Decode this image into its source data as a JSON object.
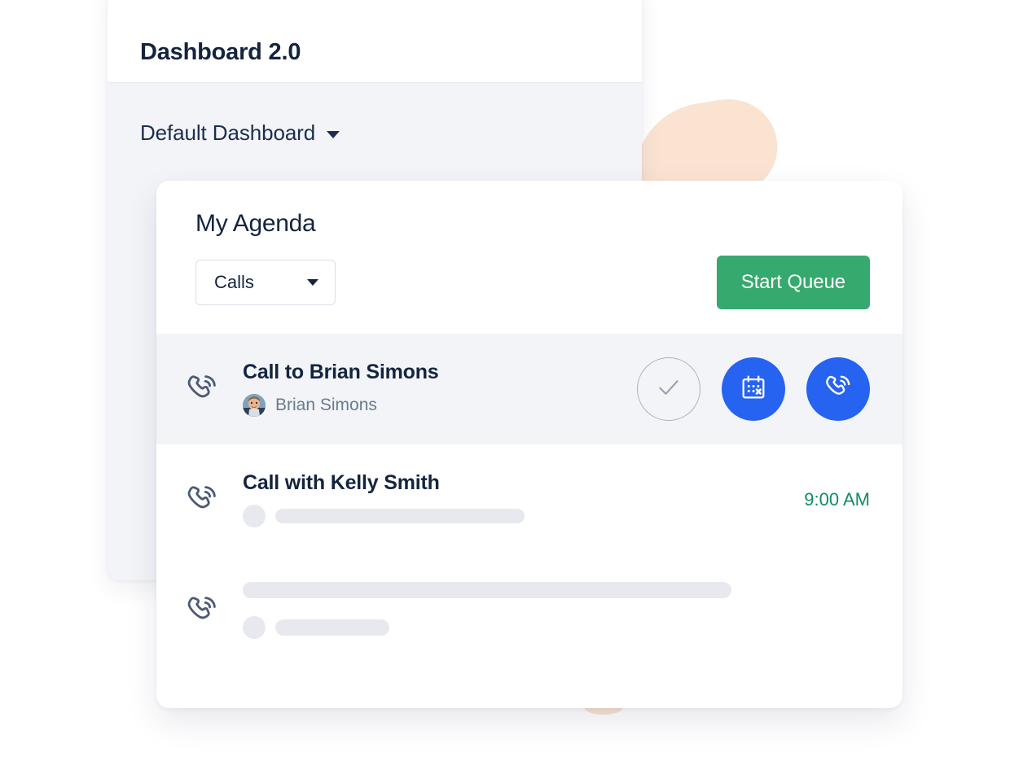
{
  "back_card": {
    "title": "Dashboard 2.0",
    "selector": {
      "label": "Default Dashboard",
      "icon": "chevron-down-icon"
    }
  },
  "agenda_card": {
    "title": "My Agenda",
    "filter": {
      "selected": "Calls",
      "icon": "chevron-down-icon"
    },
    "start_queue_label": "Start Queue",
    "rows": [
      {
        "icon": "phone-call-icon",
        "title": "Call to Brian Simons",
        "contact_name": "Brian Simons",
        "avatar": "user-photo-avatar",
        "time": "",
        "active": true,
        "actions": [
          {
            "icon": "check-icon",
            "style": "outline",
            "name": "complete-task-button"
          },
          {
            "icon": "calendar-cancel-icon",
            "style": "filled",
            "name": "reschedule-task-button"
          },
          {
            "icon": "phone-call-icon",
            "style": "filled",
            "name": "call-now-button"
          }
        ]
      },
      {
        "icon": "phone-call-icon",
        "title": "Call with Kelly Smith",
        "contact_name": "",
        "time": "9:00 AM",
        "active": false,
        "actions": []
      },
      {
        "icon": "phone-call-icon",
        "title": "",
        "contact_name": "",
        "time": "",
        "active": false,
        "actions": []
      }
    ]
  },
  "colors": {
    "accent_blue": "#2563F0",
    "accent_green": "#36A96E",
    "time_green": "#0E8E5F",
    "navy_text": "#14243F",
    "muted_text": "#6B7A90",
    "row_active_bg": "#F2F4F7",
    "back_card_bg": "#F2F4F7",
    "blob_peach": "#FBE3D2",
    "skeleton_gray": "#E7E9EF"
  }
}
